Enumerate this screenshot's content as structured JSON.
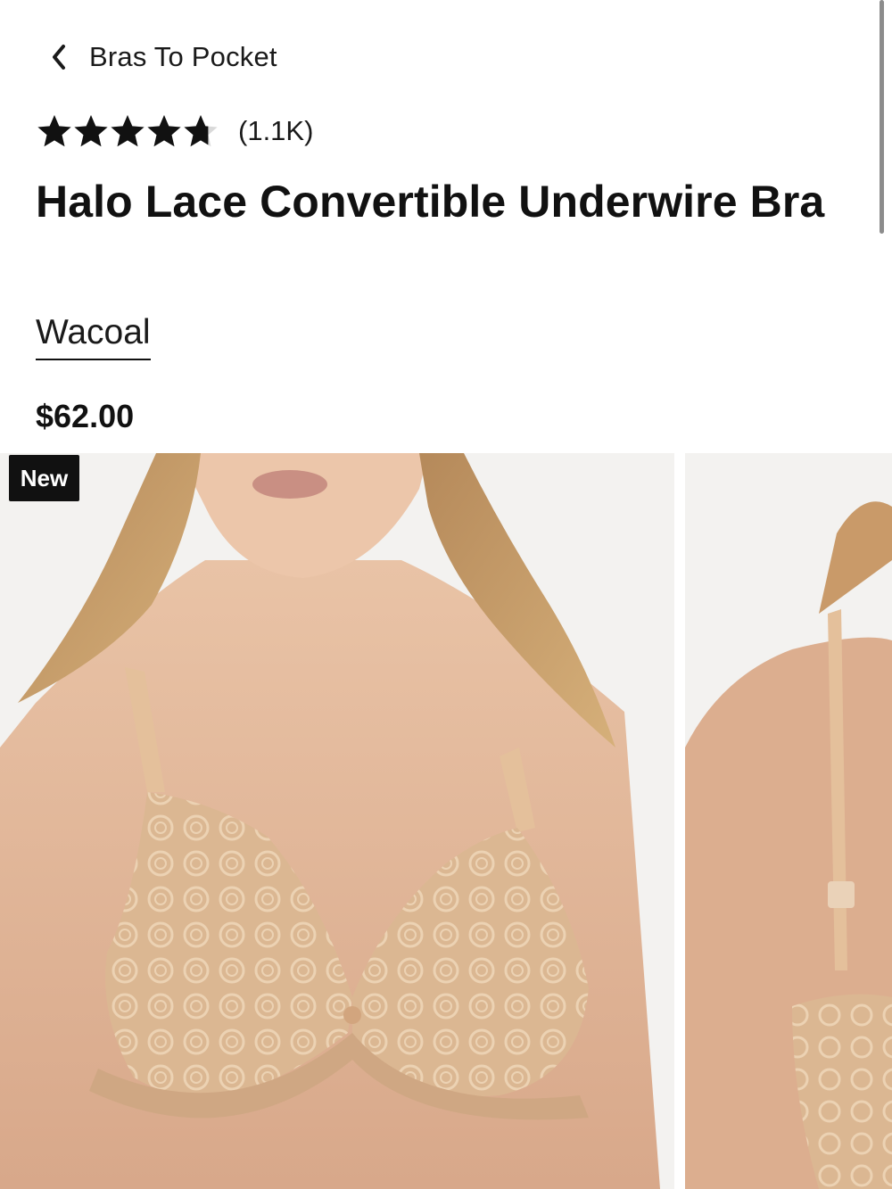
{
  "nav": {
    "back_label": "Bras To Pocket",
    "back_icon": "chevron-left-icon"
  },
  "rating": {
    "value": 4.7,
    "max": 5,
    "count_label": "(1.1K)",
    "star_color": "#111111",
    "empty_color": "#d9d9d9"
  },
  "product": {
    "title": "Halo Lace Convertible Underwire Bra",
    "brand": "Wacoal",
    "price": "$62.00"
  },
  "gallery": {
    "badge": "New",
    "images": [
      "product-front-image",
      "product-back-image"
    ]
  },
  "colors": {
    "text": "#111111",
    "badge_bg": "#111111",
    "image_bg": "#f3f2f0",
    "product_tone": "#d9b48f"
  }
}
